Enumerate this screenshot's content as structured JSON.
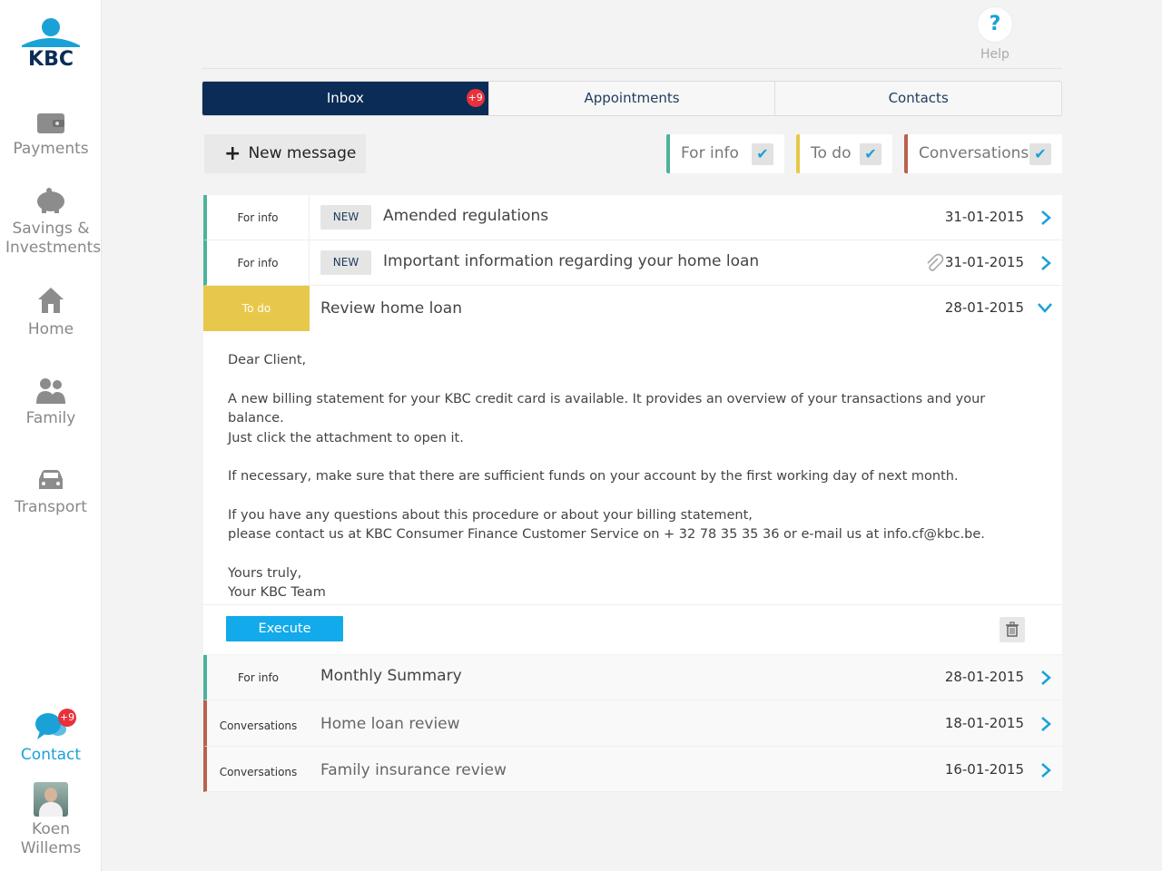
{
  "brand": {
    "name": "KBC",
    "primary": "#0b2c57",
    "accent": "#1aa2d8"
  },
  "sidebar": {
    "items": [
      {
        "label": "Payments",
        "icon": "wallet-icon"
      },
      {
        "label": "Savings & Investments",
        "icon": "piggy-bank-icon"
      },
      {
        "label": "Home",
        "icon": "house-icon"
      },
      {
        "label": "Family",
        "icon": "family-icon"
      },
      {
        "label": "Transport",
        "icon": "car-icon"
      }
    ],
    "contact": {
      "label": "Contact",
      "badge": "+9",
      "icon": "chat-icon"
    },
    "user": {
      "first": "Koen",
      "last": "Willems"
    }
  },
  "help": {
    "label": "Help"
  },
  "tabs": [
    {
      "label": "Inbox",
      "badge": "+9",
      "active": true
    },
    {
      "label": "Appointments"
    },
    {
      "label": "Contacts"
    }
  ],
  "toolbar": {
    "new_message": "New message"
  },
  "filters": [
    {
      "label": "For info",
      "color": "#4bb39b",
      "checked": true
    },
    {
      "label": "To do",
      "color": "#e8c84a",
      "checked": true
    },
    {
      "label": "Conversations",
      "color": "#b8624a",
      "checked": true
    }
  ],
  "messages": [
    {
      "type": "For info",
      "new": "NEW",
      "subject": "Amended regulations",
      "date": "31-01-2015"
    },
    {
      "type": "For info",
      "new": "NEW",
      "subject": "Important information regarding your home loan",
      "date": "31-01-2015",
      "attachment": true
    },
    {
      "type": "To do",
      "subject": "Review home loan",
      "date": "28-01-2015",
      "expanded": true
    },
    {
      "type": "For info",
      "subject": "Monthly Summary",
      "date": "28-01-2015"
    },
    {
      "type": "Conversations",
      "subject": "Home loan review",
      "date": "18-01-2015"
    },
    {
      "type": "Conversations",
      "subject": "Family insurance review",
      "date": "16-01-2015"
    }
  ],
  "expanded_body": {
    "greeting": "Dear Client,",
    "line1": "A new billing statement for your KBC credit card is available. It provides an overview of your transactions and your balance.",
    "line2": "Just click the attachment to open it.",
    "line3": "If necessary, make sure that there are sufficient funds on your account by the first working day of next month.",
    "line4": "If you have any questions about this procedure or about your billing statement,",
    "line5": "please contact us at KBC Consumer Finance Customer Service on + 32 78 35 35 36 or e-mail us at info.cf@kbc.be.",
    "closing1": "Yours truly,",
    "closing2": "Your KBC Team",
    "execute": "Execute"
  }
}
